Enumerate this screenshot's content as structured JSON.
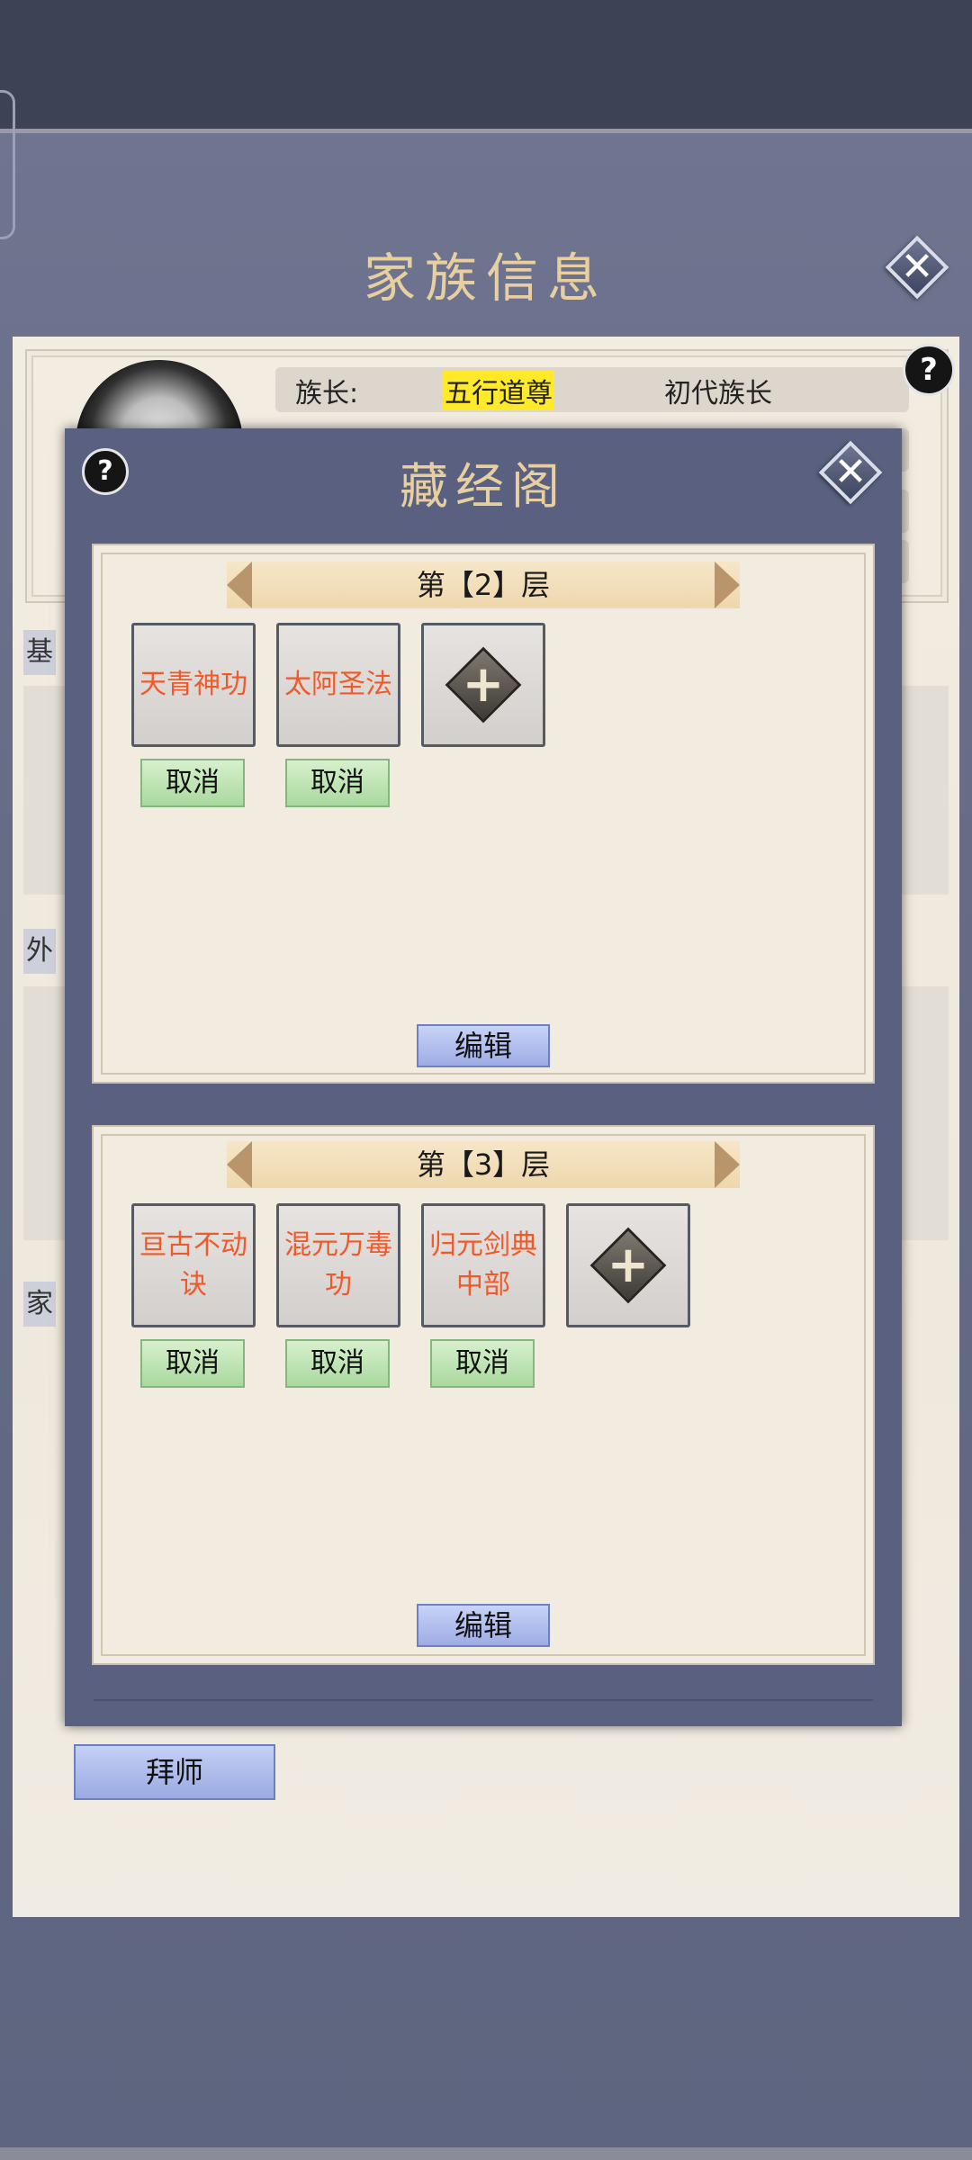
{
  "family_info": {
    "title": "家族信息",
    "leader_label": "族长:",
    "leader_name": "五行道尊",
    "leader_title": "初代族长",
    "section_1": "基",
    "section_2": "外",
    "section_3": "家",
    "apprentice_button": "拜师",
    "help": "?",
    "close": "✕"
  },
  "library": {
    "title": "藏经阁",
    "help": "?",
    "close": "✕",
    "floors": [
      {
        "label": "第【2】层",
        "skills": [
          "天青神功",
          "太阿圣法"
        ],
        "cancel_label": "取消",
        "add_icon": "plus-icon",
        "edit_label": "编辑"
      },
      {
        "label": "第【3】层",
        "skills": [
          "亘古不动诀",
          "混元万毒功",
          "归元剑典中部"
        ],
        "cancel_label": "取消",
        "add_icon": "plus-icon",
        "edit_label": "编辑"
      }
    ]
  },
  "colors": {
    "skill_text": "#f05a2a",
    "title_gold": "#e8cfa0",
    "leader_highlight": "#ffe92b"
  }
}
